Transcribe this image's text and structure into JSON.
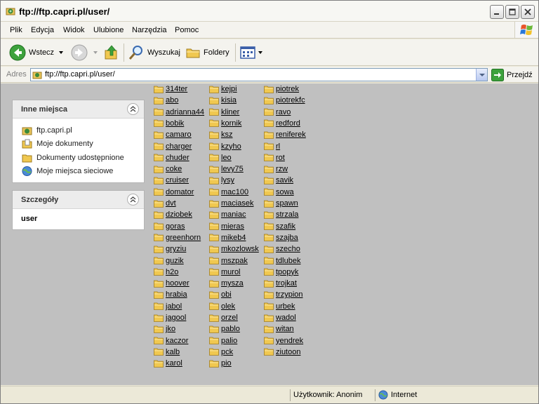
{
  "window": {
    "title": "ftp://ftp.capri.pl/user/"
  },
  "menu": [
    "Plik",
    "Edycja",
    "Widok",
    "Ulubione",
    "Narzędzia",
    "Pomoc"
  ],
  "toolbar": {
    "back_label": "Wstecz",
    "search_label": "Wyszukaj",
    "folders_label": "Foldery"
  },
  "address": {
    "label": "Adres",
    "value": "ftp://ftp.capri.pl/user/",
    "go_label": "Przejdź"
  },
  "other_places": {
    "title": "Inne miejsca",
    "items": [
      {
        "label": "ftp.capri.pl",
        "icon": "ftp-site-icon"
      },
      {
        "label": "Moje dokumenty",
        "icon": "my-documents-icon"
      },
      {
        "label": "Dokumenty udostępnione",
        "icon": "shared-folder-icon"
      },
      {
        "label": "Moje miejsca sieciowe",
        "icon": "network-places-icon"
      }
    ]
  },
  "details": {
    "title": "Szczegóły",
    "name": "user"
  },
  "folders": {
    "col1": [
      "314ter",
      "abo",
      "adrianna44",
      "bobik",
      "camaro",
      "charger",
      "chuder",
      "coke",
      "cruiser",
      "domator",
      "dvt",
      "dziobek",
      "goras",
      "greenhorn",
      "gryziu",
      "guzik",
      "h2o",
      "hoover",
      "hrabia",
      "jabol",
      "jagool",
      "jko",
      "kaczor",
      "kalb",
      "karol"
    ],
    "col2": [
      "kejpi",
      "kisia",
      "kliner",
      "kornik",
      "ksz",
      "kzyho",
      "leo",
      "levy75",
      "lysy",
      "mac100",
      "maciasek",
      "maniac",
      "mieras",
      "mikeb4",
      "mkozlowsk",
      "mszpak",
      "murol",
      "mysza",
      "obi",
      "olek",
      "orzel",
      "pablo",
      "palio",
      "pck",
      "pio"
    ],
    "col3": [
      "piotrek",
      "piotrekfc",
      "ravo",
      "redford",
      "reniferek",
      "rl",
      "rot",
      "rzw",
      "savik",
      "sowa",
      "spawn",
      "strzala",
      "szafik",
      "szajba",
      "szecho",
      "tdlubek",
      "tpopyk",
      "trojkat",
      "trzypion",
      "urbek",
      "wadol",
      "witan",
      "yendrek",
      "ziutoon"
    ]
  },
  "status": {
    "user": "Użytkownik: Anonim",
    "zone": "Internet"
  },
  "colors": {
    "folder": "#f0c850",
    "pane_bg": "#c0c0c0"
  }
}
